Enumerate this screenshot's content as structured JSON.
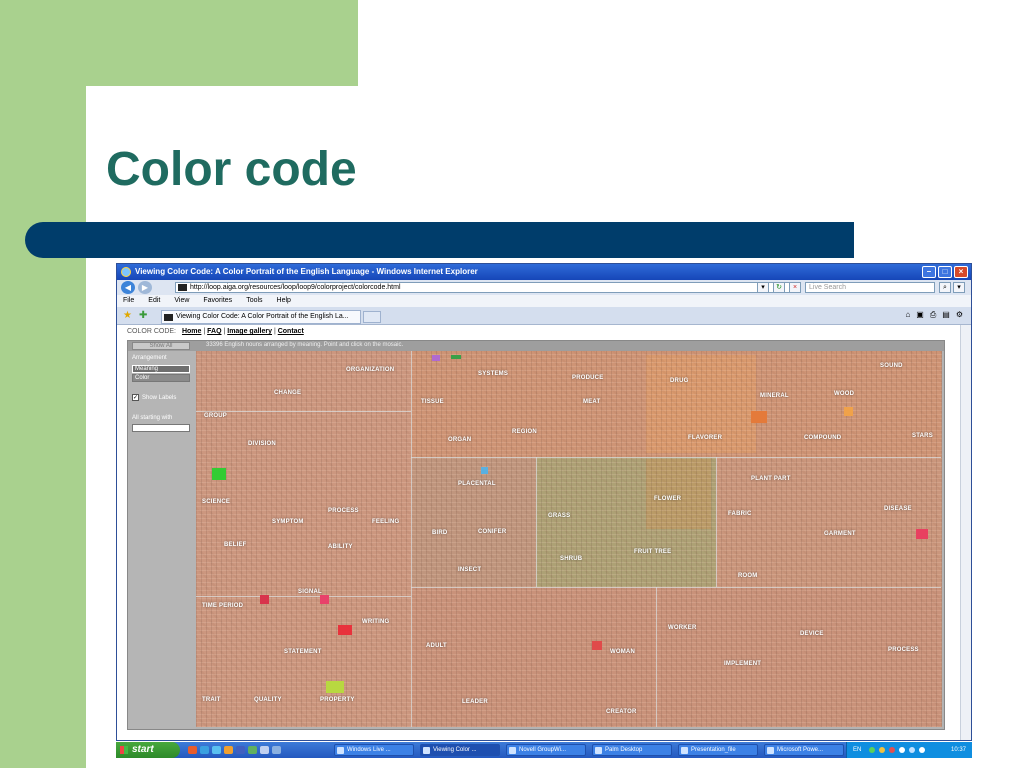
{
  "slide": {
    "title": "Color code",
    "colors": {
      "green": "#a9d18e",
      "title": "#1f6b60",
      "bar": "#003d6b"
    }
  },
  "browser": {
    "window_title": "Viewing Color Code: A Color Portrait of the English Language - Windows Internet Explorer",
    "address": "http://loop.aiga.org/resources/loop/loop9/colorproject/colorcode.html",
    "search_placeholder": "Live Search",
    "menu": [
      "File",
      "Edit",
      "View",
      "Favorites",
      "Tools",
      "Help"
    ],
    "tab_title": "Viewing Color Code: A Color Portrait of the English La...",
    "icons": [
      "back-icon",
      "forward-icon",
      "refresh-icon",
      "stop-icon",
      "search-icon",
      "home-icon",
      "print-icon",
      "favorites-star-icon"
    ]
  },
  "page": {
    "nav_label": "COLOR CODE:",
    "nav_links": [
      "Home",
      "FAQ",
      "Image gallery",
      "Contact"
    ],
    "show_all": "Show All",
    "instructions": "33396 English nouns arranged by meaning. Point and click on the mosaic.",
    "arrangement_label": "Arrangement",
    "arrangement_options": [
      "Meaning",
      "Color"
    ],
    "show_labels": "Show Labels",
    "show_labels_checked": true,
    "filter_label": "All starting with",
    "filter_value": ""
  },
  "mosaic": {
    "labels": [
      "ORGANIZATION",
      "CHANGE",
      "GROUP",
      "DIVISION",
      "SCIENCE",
      "SYMPTOM",
      "PROCESS",
      "FEELING",
      "ABILITY",
      "BELIEF",
      "TIME PERIOD",
      "SIGNAL",
      "WRITING",
      "STATEMENT",
      "TRAIT",
      "QUALITY",
      "PROPERTY",
      "SYSTEMS",
      "PRODUCE",
      "DRUG",
      "TISSUE",
      "MEAT",
      "REGION",
      "ORGAN",
      "MINERAL",
      "WOOD",
      "SOUND",
      "FLAVORER",
      "COMPOUND",
      "STARS",
      "PLACENTAL",
      "BIRD",
      "CONIFER",
      "INSECT",
      "GRASS",
      "FLOWER",
      "SHRUB",
      "FRUIT TREE",
      "PLANT PART",
      "FABRIC",
      "DISEASE",
      "GARMENT",
      "ROOM",
      "WORKER",
      "DEVICE",
      "ADULT",
      "WOMAN",
      "IMPLEMENT",
      "PROCESS",
      "LEADER",
      "CREATOR"
    ]
  },
  "taskbar": {
    "start": "start",
    "items": [
      "Windows Live ...",
      "Viewing Color ...",
      "Novell GroupWi...",
      "Palm Desktop",
      "Presentation_file",
      "Microsoft Powe..."
    ],
    "language": "EN",
    "clock": "10:37"
  }
}
